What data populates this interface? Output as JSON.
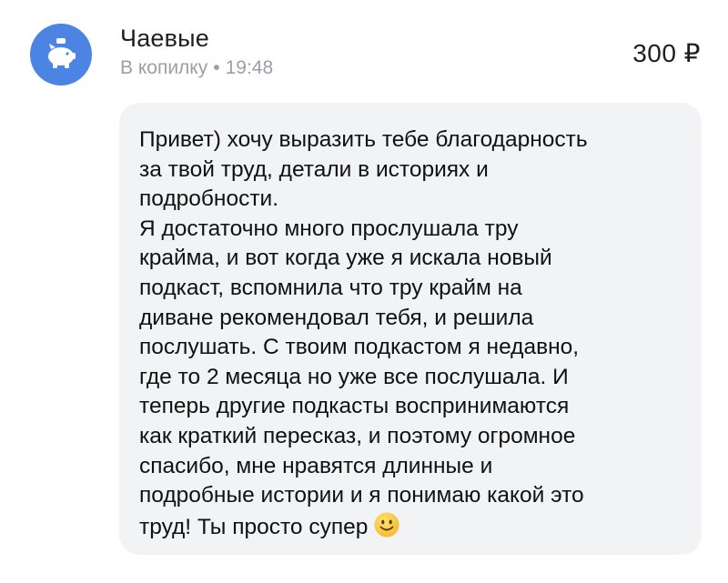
{
  "header": {
    "avatar_icon": "piggy-bank-icon",
    "title": "Чаевые",
    "subtitle_destination": "В копилку",
    "subtitle_separator": "•",
    "time": "19:48",
    "amount": "300 ₽"
  },
  "message": {
    "lines": [
      "Привет) хочу выразить тебе благодарность",
      "за твой труд, детали в историях и",
      "подробности.",
      "Я достаточно много прослушала тру",
      "крайма, и вот когда уже я искала новый",
      "подкаст, вспомнила что тру крайм на",
      "диване рекомендовал тебя, и решила",
      "послушать. С твоим подкастом я недавно,",
      "где то 2 месяца но уже все послушала. И",
      "теперь другие подкасты воспринимаются",
      "как краткий пересказ, и поэтому огромное",
      "спасибо, мне нравятся длинные и",
      "подробные истории и я понимаю какой это",
      "труд! Ты просто супер"
    ],
    "trailing_icon": "slightly-smiling-face-emoji"
  },
  "colors": {
    "avatar_background": "#4c84e3",
    "bubble_background": "#f2f3f5",
    "subtitle_text": "#9a9ea6"
  }
}
